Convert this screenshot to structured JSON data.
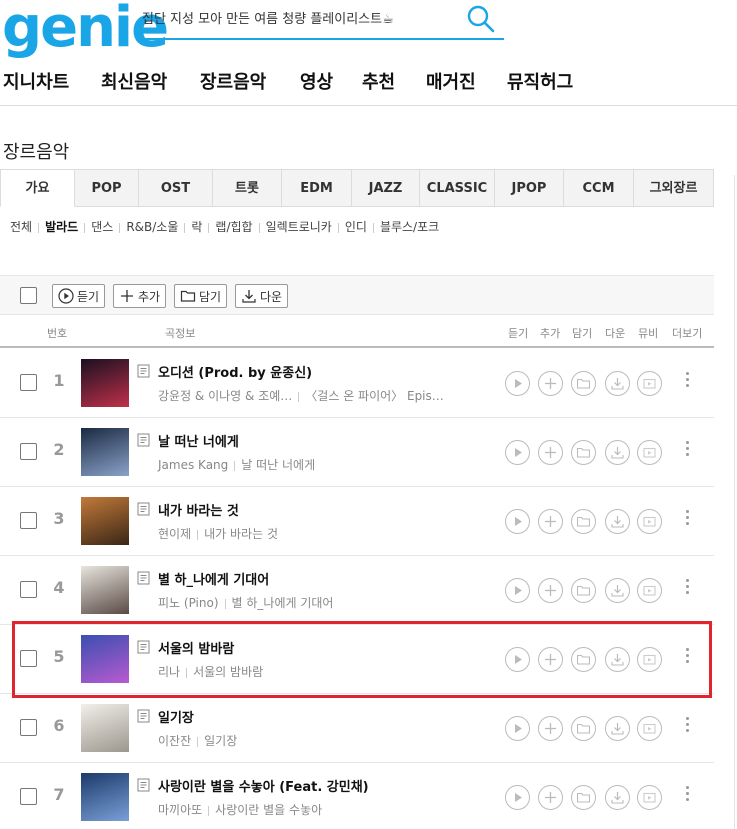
{
  "header": {
    "logo": "genie",
    "search_placeholder": "집단 지성 모아 만든 여름 청량 플레이리스트☕"
  },
  "gnb": [
    "지니차트",
    "최신음악",
    "장르음악",
    "영상",
    "추천",
    "매거진",
    "뮤직허그"
  ],
  "page_title": "장르음악",
  "tabs": [
    "가요",
    "POP",
    "OST",
    "트롯",
    "EDM",
    "JAZZ",
    "CLASSIC",
    "JPOP",
    "CCM",
    "그외장르"
  ],
  "active_tab": "가요",
  "subgenres": [
    "전체",
    "발라드",
    "댄스",
    "R&B/소울",
    "락",
    "랩/힙합",
    "일렉트로니카",
    "인디",
    "블루스/포크"
  ],
  "active_subgenre": "발라드",
  "toolbar": {
    "play": "듣기",
    "add": "추가",
    "save": "담기",
    "download": "다운"
  },
  "columns": {
    "no": "번호",
    "song": "곡정보",
    "listen": "듣기",
    "add": "추가",
    "save": "담기",
    "download": "다운",
    "mv": "뮤비",
    "more": "더보기"
  },
  "songs": [
    {
      "no": "1",
      "title": "오디션 (Prod. by 윤종신)",
      "artist": "강윤정 & 이나영 & 조예…",
      "album": "〈걸스 온 파이어〉 Epis…",
      "art_colors": [
        "#1a1020",
        "#c0304a"
      ]
    },
    {
      "no": "2",
      "title": "날 떠난 너에게",
      "artist": "James Kang",
      "album": "날 떠난 너에게",
      "art_colors": [
        "#1b2a44",
        "#8aa2c8"
      ]
    },
    {
      "no": "3",
      "title": "내가 바라는 것",
      "artist": "현이제",
      "album": "내가 바라는 것",
      "art_colors": [
        "#c27a3a",
        "#3a2616"
      ]
    },
    {
      "no": "4",
      "title": "별 하_나에게 기대어",
      "artist": "피노 (Pino)",
      "album": "별 하_나에게 기대어",
      "art_colors": [
        "#e8e4de",
        "#5a4a44"
      ]
    },
    {
      "no": "5",
      "title": "서울의 밤바람",
      "artist": "리나",
      "album": "서울의 밤바람",
      "art_colors": [
        "#3a4fb0",
        "#b85ad0"
      ]
    },
    {
      "no": "6",
      "title": "일기장",
      "artist": "이잔잔",
      "album": "일기장",
      "art_colors": [
        "#f2efe8",
        "#9b978f"
      ]
    },
    {
      "no": "7",
      "title": "사랑이란 별을 수놓아 (Feat. 강민채)",
      "artist": "마끼아또",
      "album": "사랑이란 별을 수놓아",
      "art_colors": [
        "#1c3a6a",
        "#7aa0d8"
      ]
    }
  ],
  "highlighted_row": "5",
  "colors": {
    "brand": "#1aa5e6",
    "highlight": "#e0262d"
  }
}
